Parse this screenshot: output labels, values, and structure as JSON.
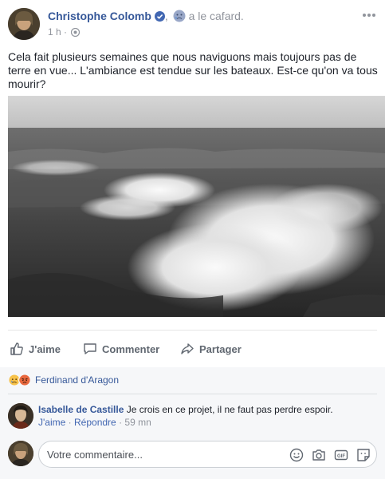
{
  "post": {
    "author": "Christophe Colomb",
    "feeling_sep": ",",
    "feeling": "a le cafard.",
    "time": "1 h",
    "time_sep": "·",
    "text": "Cela fait plusieurs semaines que nous naviguons mais toujours pas de terre en vue... L'ambiance est tendue sur les bateaux. Est-ce qu'on va tous mourir?"
  },
  "actions": {
    "like": "J'aime",
    "comment": "Commenter",
    "share": "Partager"
  },
  "reactions": {
    "names": "Ferdinand d'Aragon"
  },
  "comment": {
    "author": "Isabelle de Castille",
    "text": "Je crois en ce projet, il ne faut pas perdre espoir.",
    "like": "J'aime",
    "sep1": "·",
    "reply": "Répondre",
    "sep2": "·",
    "time": "59 mn"
  },
  "composer": {
    "placeholder": "Votre commentaire..."
  },
  "colors": {
    "link": "#365899",
    "muted": "#90949c",
    "action": "#606770"
  }
}
